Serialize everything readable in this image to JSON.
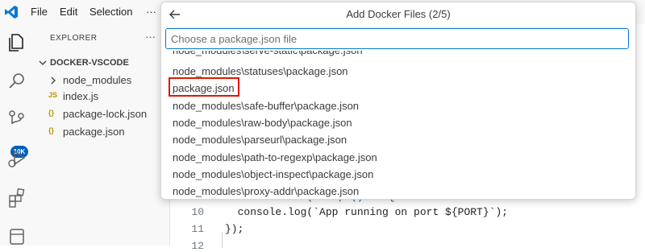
{
  "menu": {
    "file": "File",
    "edit": "Edit",
    "selection": "Selection",
    "more": "···"
  },
  "activity_bar": {
    "scm_badge": "10K"
  },
  "explorer": {
    "title": "EXPLORER",
    "more": "···",
    "folder": "DOCKER-VSCODE",
    "items": [
      {
        "label": "node_modules",
        "icon": "chevron-right-icon"
      },
      {
        "label": "index.js",
        "icon": "js-file-icon",
        "icon_text": "JS"
      },
      {
        "label": "package-lock.json",
        "icon": "json-file-icon",
        "icon_text": "{}"
      },
      {
        "label": "package.json",
        "icon": "json-file-icon",
        "icon_text": "{}"
      }
    ]
  },
  "editor": {
    "lines": [
      {
        "number": "10",
        "code": "  console.log(`App running on port ${PORT}`);"
      },
      {
        "number": "11",
        "code": "});"
      },
      {
        "number": "12",
        "code": ""
      }
    ],
    "partial_line": "server.listen(PORT, () => {"
  },
  "quick_pick": {
    "title": "Add Docker Files (2/5)",
    "placeholder": "Choose a package.json file",
    "items": [
      "node_modules\\serve-static\\package.json",
      "node_modules\\statuses\\package.json",
      "package.json",
      "node_modules\\safe-buffer\\package.json",
      "node_modules\\raw-body\\package.json",
      "node_modules\\parseurl\\package.json",
      "node_modules\\path-to-regexp\\package.json",
      "node_modules\\object-inspect\\package.json",
      "node_modules\\proxy-addr\\package.json"
    ],
    "highlighted_item": "package.json",
    "highlight_color": "#e51400"
  },
  "colors": {
    "accent": "#005fb8",
    "focus_border": "#0078d4",
    "highlight": "#e51400"
  }
}
